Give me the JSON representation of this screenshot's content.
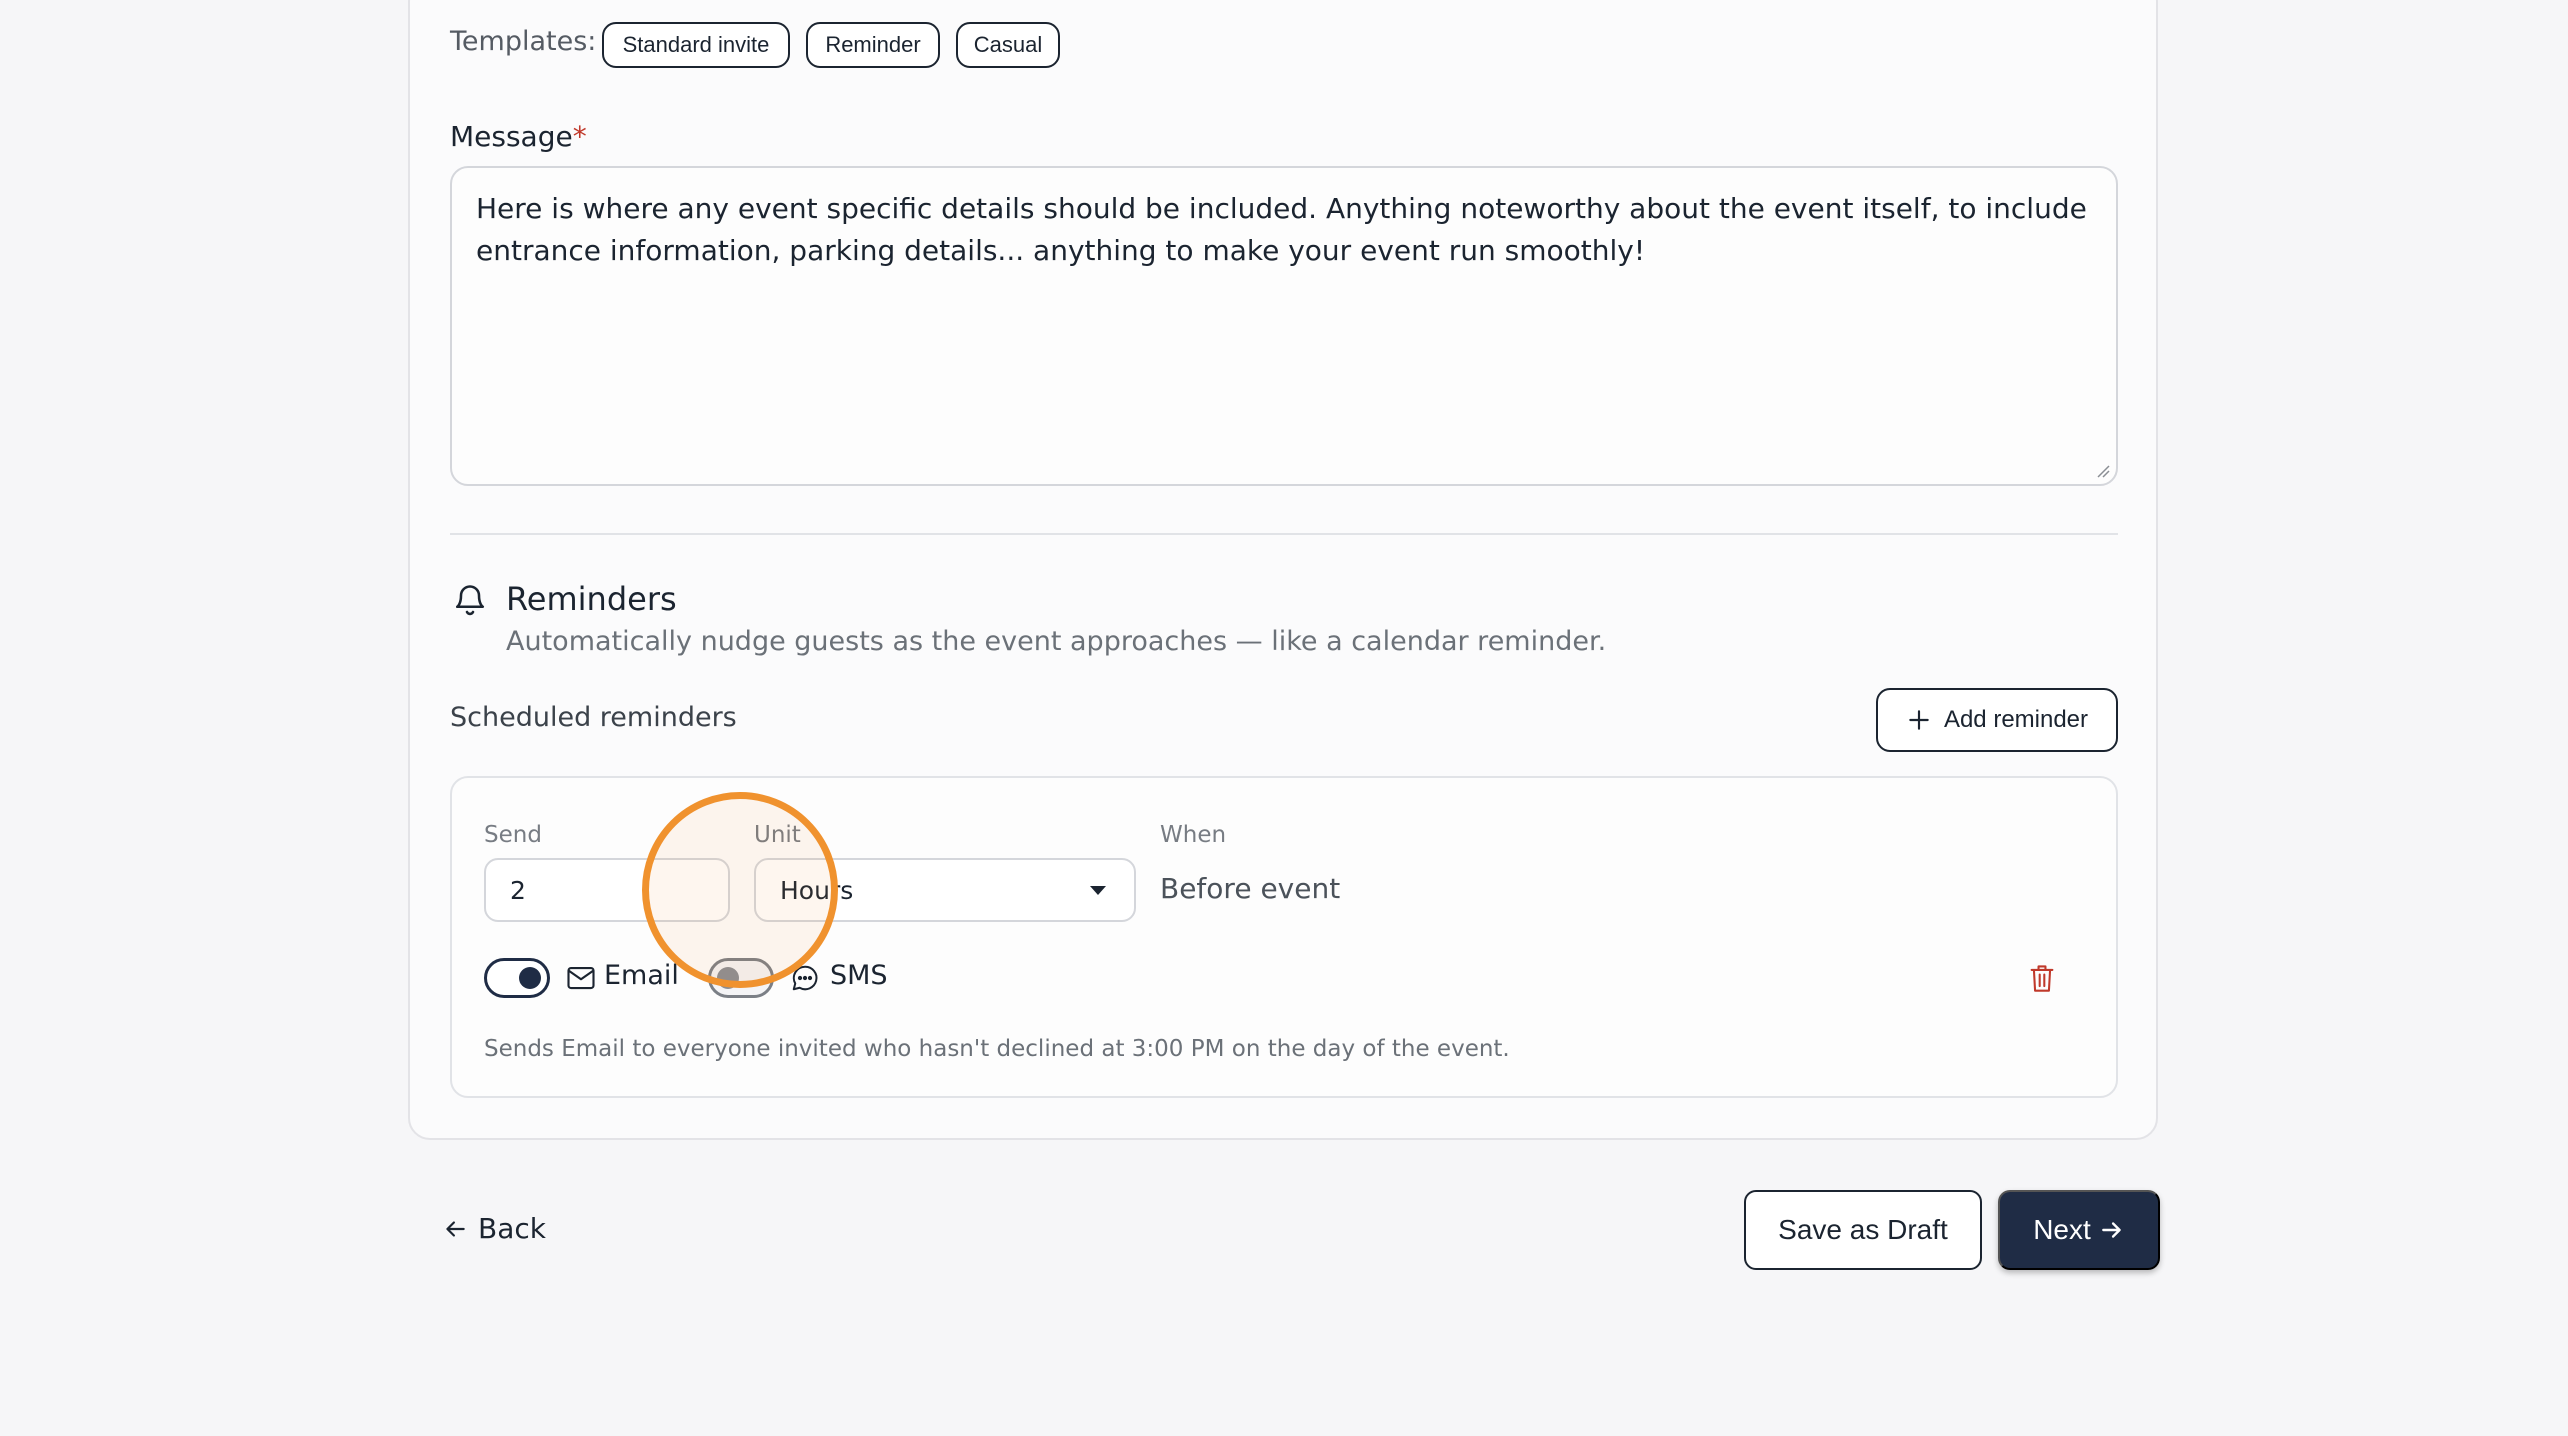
{
  "templates": {
    "label": "Templates:",
    "chips": [
      "Standard invite",
      "Reminder",
      "Casual"
    ]
  },
  "message": {
    "label": "Message",
    "required_mark": "*",
    "value": "Here is where any event specific details should be included. Anything noteworthy about the event itself, to include entrance information, parking details... anything to make your event run smoothly!"
  },
  "reminders": {
    "icon": "bell-icon",
    "title": "Reminders",
    "subtitle": "Automatically nudge guests as the event approaches — like a calendar reminder.",
    "scheduled_label": "Scheduled reminders",
    "add_button": "Add reminder",
    "item": {
      "send_label": "Send",
      "send_value": "2",
      "unit_label": "Unit",
      "unit_value": "Hours",
      "when_label": "When",
      "when_value": "Before event",
      "email_label": "Email",
      "email_enabled": true,
      "sms_label": "SMS",
      "sms_enabled": false,
      "note": "Sends Email to everyone invited who hasn't declined at 3:00 PM on the day of the event."
    }
  },
  "footer": {
    "back": "Back",
    "save_draft": "Save as Draft",
    "next": "Next"
  },
  "colors": {
    "primary": "#1f2c45",
    "required": "#c0392b",
    "delete": "#c0392b",
    "cursor_highlight": "#f0922e"
  }
}
